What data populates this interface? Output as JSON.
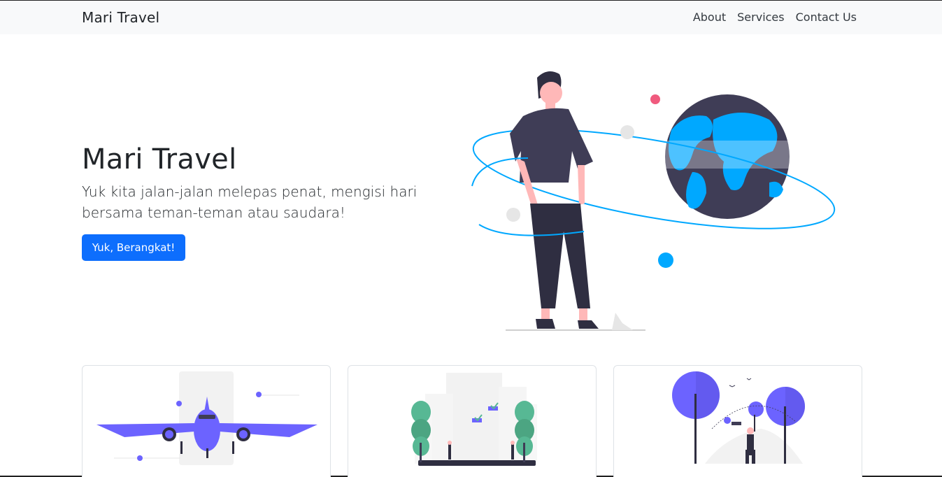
{
  "navbar": {
    "brand": "Mari Travel",
    "links": [
      "About",
      "Services",
      "Contact Us"
    ]
  },
  "hero": {
    "title": "Mari Travel",
    "subtitle": "Yuk kita jalan-jalan melepas penat, mengisi hari bersama teman-teman atau saudara!",
    "button_label": "Yuk, Berangkat!",
    "illustration_icon": "traveler-globe-illustration"
  },
  "cards": [
    {
      "illustration_icon": "airplane-illustration"
    },
    {
      "illustration_icon": "city-buildings-illustration"
    },
    {
      "illustration_icon": "park-walk-illustration"
    }
  ],
  "colors": {
    "primary": "#0d6efd",
    "navbar_bg": "#f8f9fa",
    "illustration_purple": "#6c63ff",
    "illustration_blue": "#00a8ff",
    "illustration_dark": "#3f3d56"
  }
}
